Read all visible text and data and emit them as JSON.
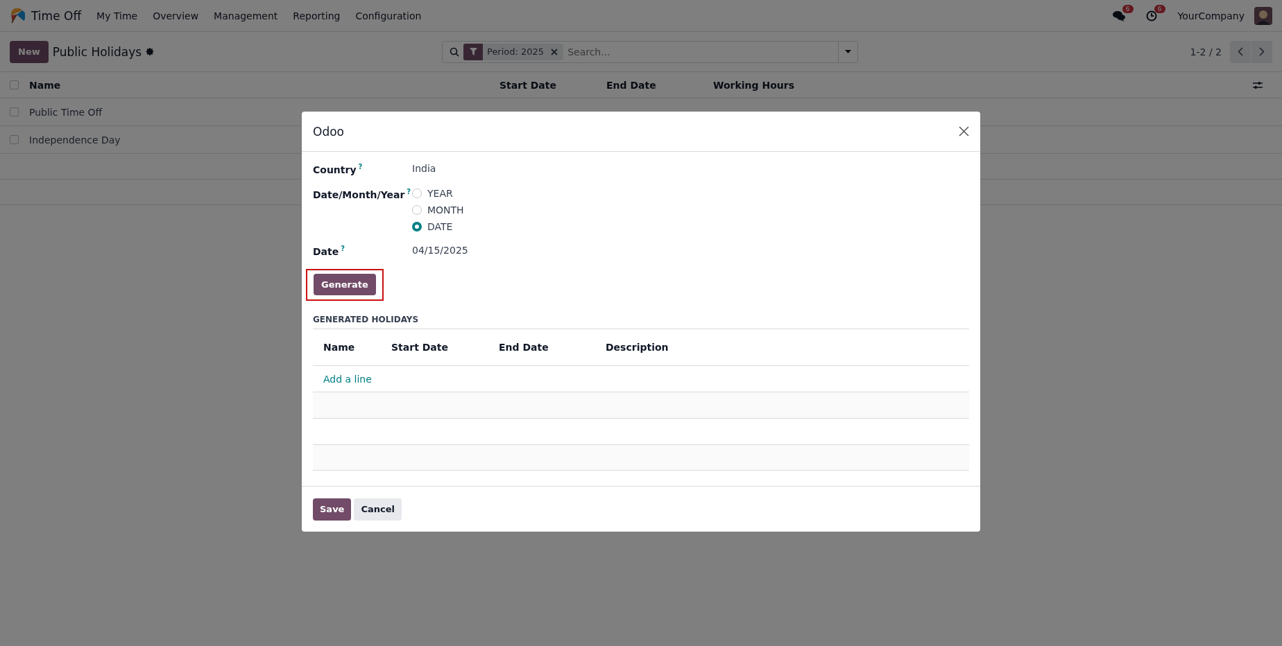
{
  "navbar": {
    "app_name": "Time Off",
    "menu": [
      "My Time",
      "Overview",
      "Management",
      "Reporting",
      "Configuration"
    ],
    "messages_badge": "6",
    "activities_badge": "6",
    "company": "YourCompany"
  },
  "control_panel": {
    "new_button": "New",
    "title": "Public Holidays",
    "facet": "Period: 2025",
    "search_placeholder": "Search...",
    "pager": "1-2 / 2"
  },
  "list": {
    "all_checked": false,
    "columns": [
      "Name",
      "Start Date",
      "End Date",
      "Working Hours"
    ],
    "rows": [
      {
        "name": "Public Time Off",
        "checked": false
      },
      {
        "name": "Independence Day",
        "checked": false
      }
    ]
  },
  "dialog": {
    "title": "Odoo",
    "fields": [
      {
        "kind": "text",
        "label": "Country",
        "help": "?",
        "value": "India"
      },
      {
        "kind": "radio",
        "label": "Date/Month/Year",
        "help": "?",
        "options": [
          {
            "label": "YEAR",
            "selected": false
          },
          {
            "label": "MONTH",
            "selected": false
          },
          {
            "label": "DATE",
            "selected": true
          }
        ]
      },
      {
        "kind": "text",
        "label": "Date",
        "help": "?",
        "value": "04/15/2025"
      }
    ],
    "generate_button": "Generate",
    "generate_highlighted": true,
    "section_title": "GENERATED HOLIDAYS",
    "table": {
      "columns": [
        "Name",
        "Start Date",
        "End Date",
        "Description"
      ],
      "add_line": "Add a line"
    },
    "buttons": [
      {
        "label": "Save",
        "kind": "primary"
      },
      {
        "label": "Cancel",
        "kind": "secondary"
      }
    ]
  }
}
